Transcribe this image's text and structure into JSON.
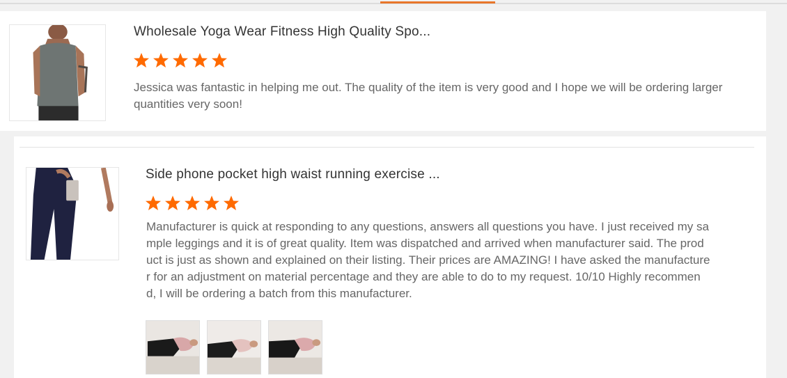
{
  "colors": {
    "accent": "#e8762a",
    "star": "#ff6a00",
    "title_text": "#333333",
    "body_text": "#666666"
  },
  "tabs": {
    "active_indicator_color": "#e8762a"
  },
  "reviews": [
    {
      "product_title": "Wholesale Yoga Wear Fitness High Quality Spo...",
      "rating": 5,
      "rating_max": 5,
      "thumbnail_icon": "tank-top-icon",
      "text": "Jessica was fantastic in helping me out. The quality of the item is very good and I hope we will be ordering larger quantities very soon!",
      "photos": []
    },
    {
      "product_title": "Side phone pocket high waist running exercise ...",
      "rating": 5,
      "rating_max": 5,
      "thumbnail_icon": "leggings-icon",
      "text_lines": [
        "Manufacturer is quick at responding to any questions, answers all questions you have. I just received my sa",
        "mple leggings and it is of great quality. Item was dispatched and arrived when manufacturer said. The prod",
        "uct is just as shown and explained on their listing. Their prices are AMAZING! I have asked the manufacture",
        "r for an adjustment on material percentage and they are able to do to my request. 10/10 Highly recommen",
        "d, I will be ordering a batch from this manufacturer."
      ],
      "photos": [
        {
          "icon": "review-photo-icon"
        },
        {
          "icon": "review-photo-icon"
        },
        {
          "icon": "review-photo-icon"
        }
      ]
    }
  ]
}
